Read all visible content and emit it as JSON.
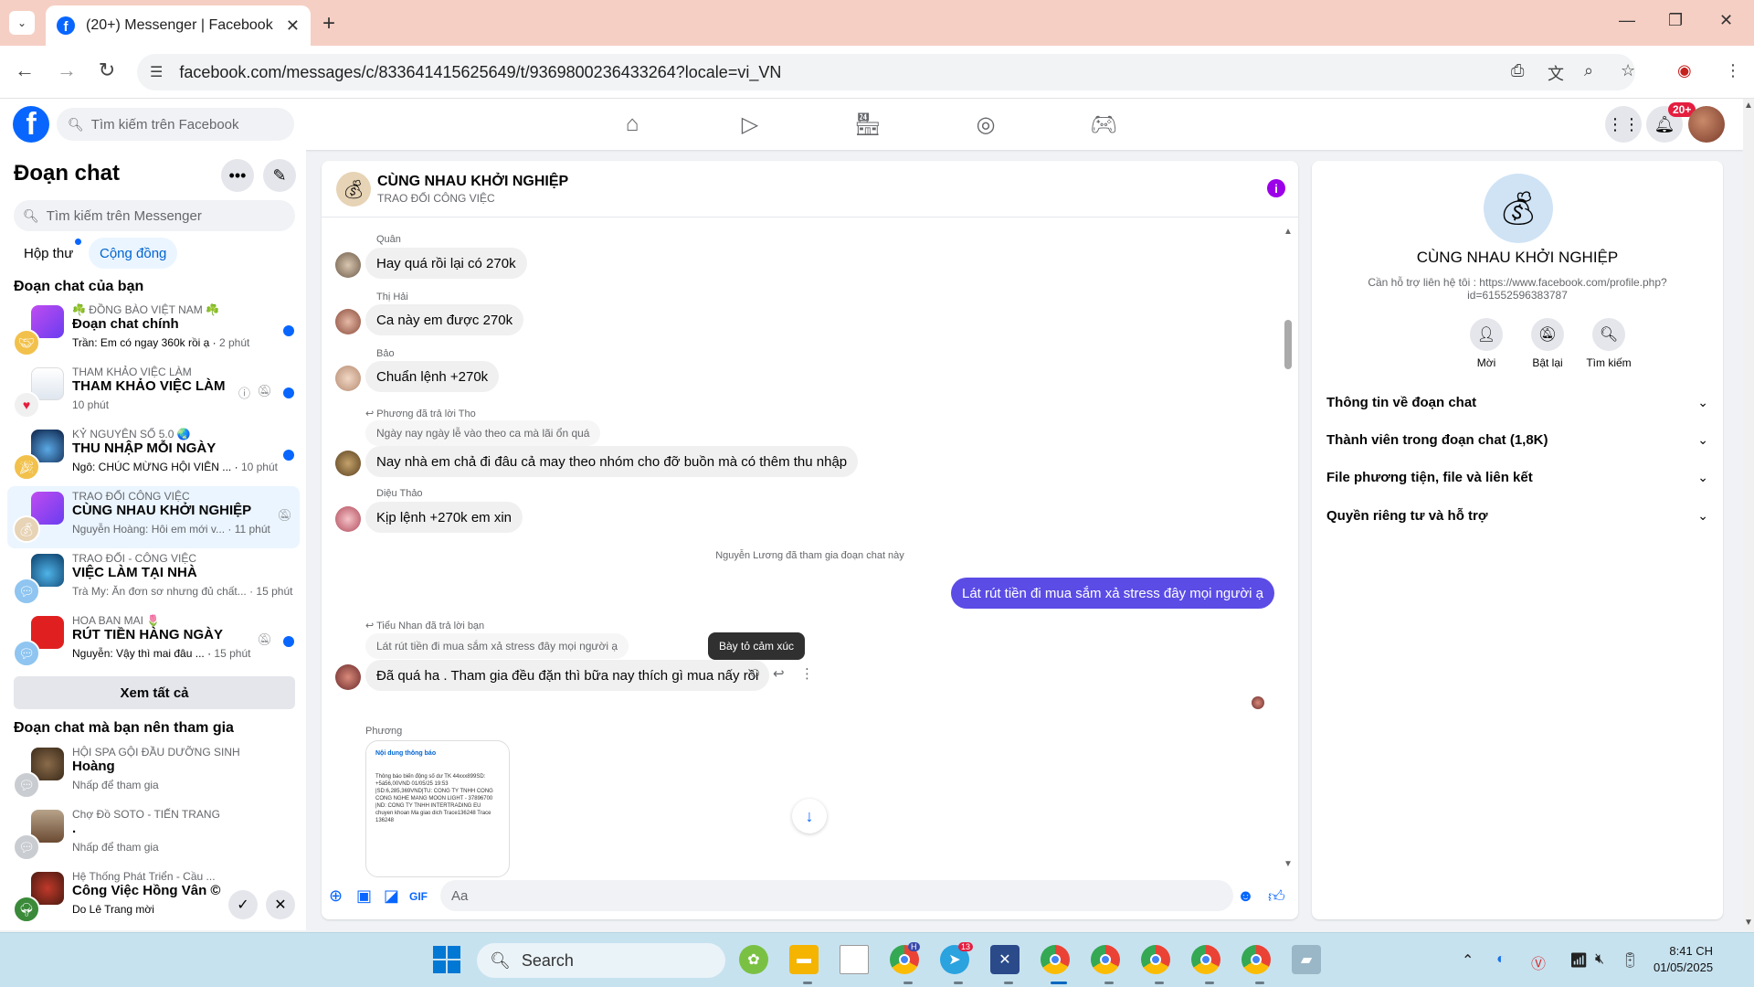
{
  "browser": {
    "tab_title": "(20+) Messenger | Facebook",
    "url": "facebook.com/messages/c/833641415625649/t/9369800236433264?locale=vi_VN"
  },
  "fb_header": {
    "search_placeholder": "Tìm kiếm trên Facebook",
    "notification_badge": "20+"
  },
  "sidebar": {
    "title": "Đoạn chat",
    "search_placeholder": "Tìm kiếm trên Messenger",
    "tabs": [
      "Hộp thư",
      "Cộng đồng"
    ],
    "section_your_chats": "Đoạn chat của bạn",
    "chats": [
      {
        "community": "☘️ ĐỒNG BÀO VIỆT NAM ☘️",
        "name": "Đoạn chat chính",
        "preview": "Trần: Em có ngay 360k rồi ạ",
        "time": "2 phút",
        "unread": true
      },
      {
        "community": "THAM KHẢO VIỆC LÀM",
        "name": "THAM KHẢO VIỆC LÀM",
        "preview": "",
        "time": "10 phút",
        "unread": true
      },
      {
        "community": "KỶ NGUYÊN SỐ 5.0 🌏",
        "name": "THU NHẬP MỖI NGÀY",
        "preview": "Ngô: CHÚC MỪNG HỘI VIÊN ...",
        "time": "10 phút",
        "unread": true
      },
      {
        "community": "TRAO ĐỔI CÔNG VIỆC",
        "name": "CÙNG NHAU KHỞI NGHIỆP",
        "preview": "Nguyễn Hoàng: Hôi em mới v...",
        "time": "11 phút",
        "unread": false
      },
      {
        "community": "TRAO ĐỔI - CÔNG VIỆC",
        "name": "VIỆC LÀM TẠI NHÀ",
        "preview": "Trà My: Ăn đơn sơ nhưng đủ chất...",
        "time": "15 phút",
        "unread": false
      },
      {
        "community": "HOA BAN MAI 🌷",
        "name": "RÚT TIỀN HÀNG NGÀY",
        "preview": "Nguyễn: Vậy thì mai đâu ...",
        "time": "15 phút",
        "unread": true
      }
    ],
    "see_all": "Xem tất cả",
    "section_suggested": "Đoạn chat mà bạn nên tham gia",
    "suggested": [
      {
        "community": "HỘI SPA GỘI ĐẦU DƯỠNG SINH",
        "name": "Hoàng",
        "preview": "Nhấp để tham gia"
      },
      {
        "community": "Chợ Đồ SOTO - TIẾN TRANG",
        "name": ".",
        "preview": "Nhấp để tham gia"
      },
      {
        "community": "Hệ Thống Phát Triển - Cầu ...",
        "name": "Công Việc Hồng Vân ©",
        "preview": "Do Lê Trang mời"
      }
    ]
  },
  "conversation": {
    "title": "CÙNG NHAU KHỞI NGHIỆP",
    "subtitle": "TRAO ĐỔI CÔNG VIỆC",
    "messages": [
      {
        "author": "Quân",
        "text": "Hay quá rồi lại có 270k"
      },
      {
        "author": "Thị Hải",
        "text": "Ca này em được 270k"
      },
      {
        "author": "Bảo",
        "text": "Chuẩn lệnh +270k"
      },
      {
        "reply_label": "Phương đã trả lời Tho",
        "quote": "Ngày nay ngày lễ vào theo ca mà lãi ổn quá",
        "text": "Nay nhà em chả đi đâu cả may theo nhóm cho đỡ buồn mà có thêm thu nhập"
      },
      {
        "author": "Diệu Thảo",
        "text": "Kịp lệnh +270k em xin"
      }
    ],
    "system_message": "Nguyễn Lương đã tham gia đoạn chat này",
    "outgoing": "Lát rút tiền đi mua sắm xả stress đây mọi người ạ",
    "reply2": {
      "label": "Tiểu Nhan đã trả lời bạn",
      "quote": "Lát rút tiền đi mua sắm xả stress đây mọi người ạ",
      "text": "Đã quá ha . Tham gia đều đặn thì bữa nay thích gì mua nấy rồi"
    },
    "tooltip": "Bày tỏ cảm xúc",
    "image_author": "Phương",
    "image_card": {
      "header": "Nội dung thông báo",
      "body": "Thông báo biến động số dư TK 44xxx899SD: +5á56,00VND 01/05/25 19:53 |SD:6,285,369VND|TU: CONG TY TNHH CONG CONG NGHE MANG MOON LIGHT - 37896700 |ND: CONG TY TNHH INTERTRADING EU chuyen khoan Ma giao dich Trace136248 Trace 136248"
    },
    "composer_placeholder": "Aa"
  },
  "info_panel": {
    "title": "CÙNG NHAU KHỞI NGHIỆP",
    "description": "Cần hỗ trợ liên hệ tôi : https://www.facebook.com/profile.php?id=61552596383787",
    "actions": [
      "Mời",
      "Bật lại",
      "Tìm kiếm"
    ],
    "sections": [
      "Thông tin về đoạn chat",
      "Thành viên trong đoạn chat (1,8K)",
      "File phương tiện, file và liên kết",
      "Quyền riêng tư và hỗ trợ"
    ]
  },
  "taskbar": {
    "search": "Search",
    "time": "8:41 CH",
    "date": "01/05/2025",
    "telegram_badge": "13",
    "chrome_badge": "H"
  },
  "colors": {
    "facebook_blue": "#0866ff",
    "outgoing_bubble": "#5b4ce6",
    "tab_bar": "#f6cfc4",
    "taskbar": "#c7e2ef"
  }
}
